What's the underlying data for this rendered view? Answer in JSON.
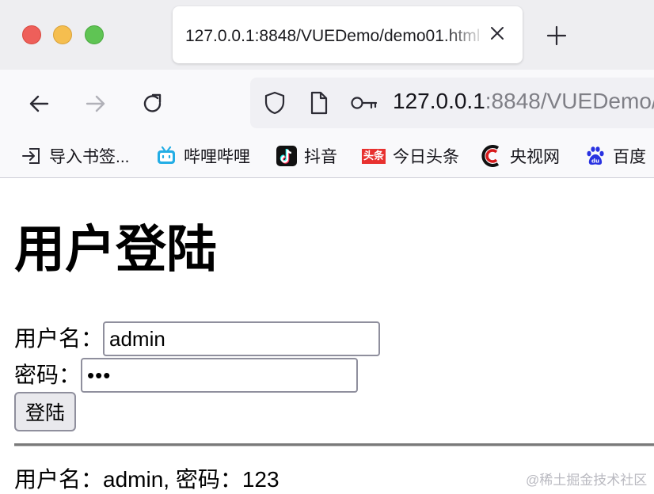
{
  "browser": {
    "tab_title": "127.0.0.1:8848/VUEDemo/demo01.html",
    "url_host": "127.0.0.1",
    "url_rest": ":8848/VUEDemo/",
    "bookmarks": [
      {
        "label": "导入书签...",
        "icon": "import-icon"
      },
      {
        "label": "哔哩哔哩",
        "icon": "bilibili-icon"
      },
      {
        "label": "抖音",
        "icon": "douyin-icon"
      },
      {
        "label": "今日头条",
        "icon": "toutiao-icon",
        "icon_text": "头条"
      },
      {
        "label": "央视网",
        "icon": "cctv-icon"
      },
      {
        "label": "百度",
        "icon": "baidu-icon"
      }
    ]
  },
  "page": {
    "title": "用户登陆",
    "username_label": "用户名：",
    "username_value": "admin",
    "password_label": "密码：",
    "password_value": "•••",
    "login_button": "登陆",
    "result_text": "用户名：admin, 密码：123"
  },
  "watermark": "@稀土掘金技术社区",
  "colors": {
    "close_light": "#ee5f5a",
    "minimize_light": "#f5be4f",
    "maximize_light": "#5fc454",
    "toutiao_red": "#e8312f",
    "baidu_blue": "#2932e1",
    "bilibili_blue": "#23ade5"
  }
}
